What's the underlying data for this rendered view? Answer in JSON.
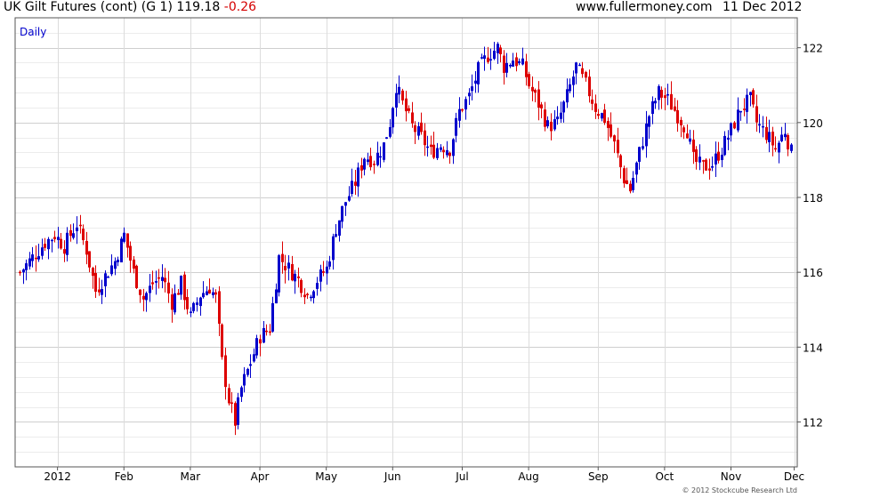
{
  "header": {
    "title": "UK Gilt Futures (cont) (G 1) 119.18",
    "change": "-0.26",
    "site": "www.fullermoney.com",
    "date": "11 Dec 2012"
  },
  "period_label": "Daily",
  "copyright": "© 2012 Stockcube Research Ltd",
  "chart_data": {
    "type": "candlestick",
    "colors": {
      "up": "#0000cc",
      "down": "#dd0000",
      "grid": "#e2e2e2",
      "frame": "#555555"
    },
    "ylim": [
      110.8,
      122.8
    ],
    "yticks": [
      112,
      114,
      116,
      118,
      120,
      122
    ],
    "ytick_labels": [
      "112",
      "114",
      "116",
      "118",
      "120",
      "122"
    ],
    "xlim_days": [
      0,
      244
    ],
    "xticks": [
      {
        "label": "2012",
        "day": 12
      },
      {
        "label": "Feb",
        "day": 33
      },
      {
        "label": "Mar",
        "day": 54
      },
      {
        "label": "Apr",
        "day": 76
      },
      {
        "label": "May",
        "day": 97
      },
      {
        "label": "Jun",
        "day": 118
      },
      {
        "label": "Jul",
        "day": 140
      },
      {
        "label": "Aug",
        "day": 161
      },
      {
        "label": "Sep",
        "day": 183
      },
      {
        "label": "Oct",
        "day": 204
      },
      {
        "label": "Nov",
        "day": 225
      },
      {
        "label": "Dec",
        "day": 245
      }
    ],
    "close_path": [
      [
        0,
        116.0
      ],
      [
        3,
        116.3
      ],
      [
        8,
        116.8
      ],
      [
        11,
        117.0
      ],
      [
        14,
        116.7
      ],
      [
        18,
        117.3
      ],
      [
        21,
        116.6
      ],
      [
        24,
        115.5
      ],
      [
        27,
        115.9
      ],
      [
        30,
        116.3
      ],
      [
        33,
        117.0
      ],
      [
        36,
        116.0
      ],
      [
        39,
        115.3
      ],
      [
        42,
        115.7
      ],
      [
        45,
        115.9
      ],
      [
        48,
        115.2
      ],
      [
        51,
        115.7
      ],
      [
        54,
        114.8
      ],
      [
        57,
        115.4
      ],
      [
        60,
        115.6
      ],
      [
        62,
        115.3
      ],
      [
        64,
        113.6
      ],
      [
        66,
        112.6
      ],
      [
        68,
        112.0
      ],
      [
        70,
        112.9
      ],
      [
        73,
        113.6
      ],
      [
        76,
        114.3
      ],
      [
        79,
        114.5
      ],
      [
        82,
        116.4
      ],
      [
        85,
        116.1
      ],
      [
        88,
        115.8
      ],
      [
        91,
        115.4
      ],
      [
        94,
        115.8
      ],
      [
        97,
        116.1
      ],
      [
        100,
        117.2
      ],
      [
        103,
        117.9
      ],
      [
        106,
        118.4
      ],
      [
        109,
        119.1
      ],
      [
        112,
        119.0
      ],
      [
        115,
        119.4
      ],
      [
        117,
        120.0
      ],
      [
        119,
        121.0
      ],
      [
        121,
        120.5
      ],
      [
        124,
        119.9
      ],
      [
        127,
        119.6
      ],
      [
        130,
        119.2
      ],
      [
        133,
        119.4
      ],
      [
        136,
        119.3
      ],
      [
        139,
        120.3
      ],
      [
        142,
        120.7
      ],
      [
        145,
        121.4
      ],
      [
        148,
        121.8
      ],
      [
        151,
        122.0
      ],
      [
        153,
        121.5
      ],
      [
        156,
        121.7
      ],
      [
        159,
        121.5
      ],
      [
        161,
        121.0
      ],
      [
        164,
        120.5
      ],
      [
        167,
        119.9
      ],
      [
        170,
        120.0
      ],
      [
        173,
        120.7
      ],
      [
        176,
        121.5
      ],
      [
        179,
        121.0
      ],
      [
        182,
        120.4
      ],
      [
        185,
        120.1
      ],
      [
        188,
        119.4
      ],
      [
        191,
        118.5
      ],
      [
        193,
        118.2
      ],
      [
        196,
        119.2
      ],
      [
        199,
        120.2
      ],
      [
        202,
        120.8
      ],
      [
        205,
        120.6
      ],
      [
        208,
        120.2
      ],
      [
        211,
        119.8
      ],
      [
        213,
        119.0
      ],
      [
        216,
        118.8
      ],
      [
        219,
        118.9
      ],
      [
        222,
        119.3
      ],
      [
        225,
        119.8
      ],
      [
        228,
        120.4
      ],
      [
        231,
        120.6
      ],
      [
        233,
        120.0
      ],
      [
        236,
        119.7
      ],
      [
        239,
        119.3
      ],
      [
        242,
        119.8
      ],
      [
        244,
        119.2
      ]
    ]
  }
}
